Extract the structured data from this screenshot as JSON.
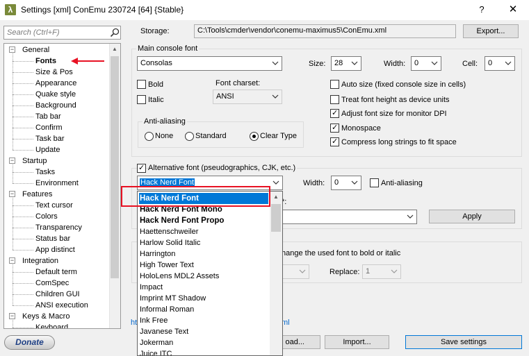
{
  "window": {
    "title": "Settings [xml] ConEmu 230724 [64] {Stable}",
    "app_icon_glyph": "λ",
    "help_glyph": "?",
    "close_glyph": "✕"
  },
  "sidebar": {
    "search_placeholder": "Search (Ctrl+F)",
    "tree": [
      {
        "label": "General",
        "level": 0,
        "expanded": true
      },
      {
        "label": "Fonts",
        "level": 1,
        "selected": true
      },
      {
        "label": "Size & Pos",
        "level": 1
      },
      {
        "label": "Appearance",
        "level": 1
      },
      {
        "label": "Quake style",
        "level": 1
      },
      {
        "label": "Background",
        "level": 1
      },
      {
        "label": "Tab bar",
        "level": 1
      },
      {
        "label": "Confirm",
        "level": 1
      },
      {
        "label": "Task bar",
        "level": 1
      },
      {
        "label": "Update",
        "level": 1
      },
      {
        "label": "Startup",
        "level": 0,
        "expanded": true
      },
      {
        "label": "Tasks",
        "level": 1
      },
      {
        "label": "Environment",
        "level": 1
      },
      {
        "label": "Features",
        "level": 0,
        "expanded": true
      },
      {
        "label": "Text cursor",
        "level": 1
      },
      {
        "label": "Colors",
        "level": 1
      },
      {
        "label": "Transparency",
        "level": 1
      },
      {
        "label": "Status bar",
        "level": 1
      },
      {
        "label": "App distinct",
        "level": 1
      },
      {
        "label": "Integration",
        "level": 0,
        "expanded": true
      },
      {
        "label": "Default term",
        "level": 1
      },
      {
        "label": "ComSpec",
        "level": 1
      },
      {
        "label": "Children GUI",
        "level": 1
      },
      {
        "label": "ANSI execution",
        "level": 1
      },
      {
        "label": "Keys & Macro",
        "level": 0,
        "expanded": true
      },
      {
        "label": "Keyboard",
        "level": 1
      }
    ],
    "donate_label": "Donate"
  },
  "storage": {
    "label": "Storage:",
    "path": "C:\\Tools\\cmder\\vendor\\conemu-maximus5\\ConEmu.xml",
    "export_label": "Export..."
  },
  "main_font": {
    "group_label": "Main console font",
    "font_value": "Consolas",
    "size_label": "Size:",
    "size_value": "28",
    "width_label": "Width:",
    "width_value": "0",
    "cell_label": "Cell:",
    "cell_value": "0",
    "bold_label": "Bold",
    "italic_label": "Italic",
    "charset_label": "Font charset:",
    "charset_value": "ANSI",
    "antialias_label": "Anti-aliasing",
    "aa_none": "None",
    "aa_standard": "Standard",
    "aa_cleartype": "Clear Type",
    "opt_auto_size": "Auto size (fixed console size in cells)",
    "opt_treat_height": "Treat font height as device units",
    "opt_adjust_dpi": "Adjust font size for monitor DPI",
    "opt_monospace": "Monospace",
    "opt_compress": "Compress long strings to fit space"
  },
  "alt_font": {
    "checkbox_label": "Alternative font (pseudographics, CJK, etc.)",
    "font_value": "Hack Nerd Font",
    "width_label": "Width:",
    "width_value": "0",
    "antialias_label": "Anti-aliasing",
    "partial_colon": "*:",
    "apply_label": "Apply"
  },
  "bold_section": {
    "partial_text": "hange the used font to bold or italic",
    "replace_label": "Replace:",
    "replace_value": "1"
  },
  "footer": {
    "link_left": "ht",
    "link_right": "ml",
    "load_label": "oad...",
    "import_label": "Import...",
    "save_label": "Save settings"
  },
  "font_list": [
    {
      "name": "Hack Nerd Font",
      "selected": true,
      "bold": true
    },
    {
      "name": "Hack Nerd Font Mono",
      "bold": true
    },
    {
      "name": "Hack Nerd Font Propo",
      "bold": true
    },
    {
      "name": "Haettenschweiler"
    },
    {
      "name": "Harlow Solid Italic"
    },
    {
      "name": "Harrington"
    },
    {
      "name": "High Tower Text"
    },
    {
      "name": "HoloLens MDL2 Assets"
    },
    {
      "name": "Impact"
    },
    {
      "name": "Imprint MT Shadow"
    },
    {
      "name": "Informal Roman"
    },
    {
      "name": "Ink Free"
    },
    {
      "name": "Javanese Text"
    },
    {
      "name": "Jokerman"
    },
    {
      "name": "Juice ITC"
    }
  ],
  "colors": {
    "selection": "#0078d7",
    "highlight": "#e81123",
    "accent_link": "#0066cc"
  }
}
